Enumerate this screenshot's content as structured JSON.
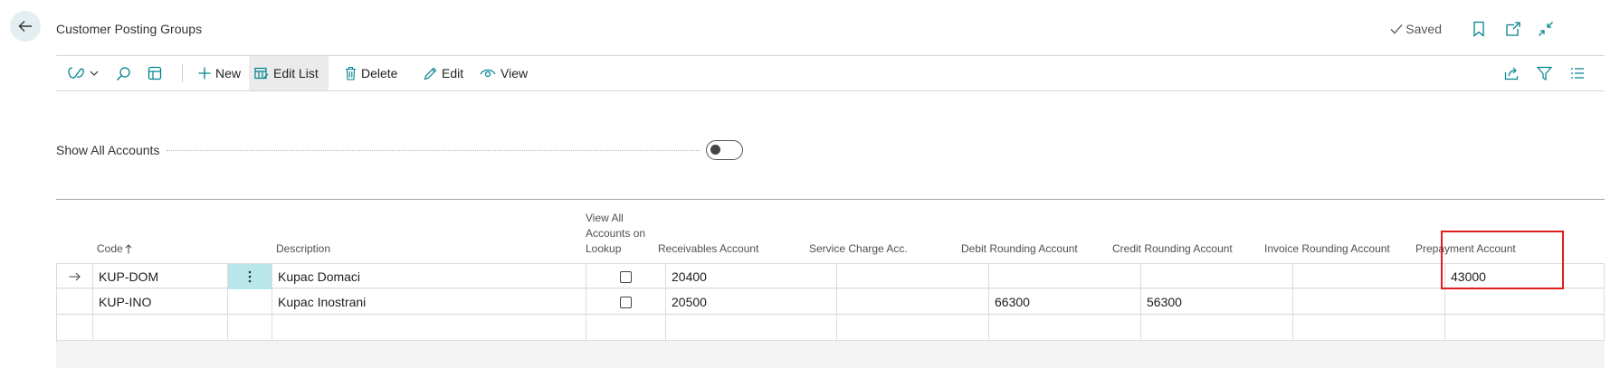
{
  "page": {
    "title": "Customer Posting Groups",
    "status": "Saved"
  },
  "toolbar": {
    "new_label": "New",
    "edit_list_label": "Edit List",
    "delete_label": "Delete",
    "edit_label": "Edit",
    "view_label": "View"
  },
  "options": {
    "show_all_accounts_label": "Show All Accounts",
    "show_all_accounts_value": false
  },
  "table": {
    "headers": {
      "code": "Code",
      "description": "Description",
      "view_all_1": "View All",
      "view_all_2": "Accounts on",
      "view_all_3": "Lookup",
      "receivables": "Receivables Account",
      "service_charge": "Service Charge Acc.",
      "debit_rounding": "Debit Rounding Account",
      "credit_rounding": "Credit Rounding Account",
      "invoice_rounding": "Invoice Rounding Account",
      "prepayment": "Prepayment Account"
    },
    "sort": {
      "column": "Code",
      "direction": "ascending"
    },
    "rows": [
      {
        "code": "KUP-DOM",
        "description": "Kupac Domaci",
        "view_all": false,
        "receivables": "20400",
        "service_charge": "",
        "debit_rounding": "",
        "credit_rounding": "",
        "invoice_rounding": "",
        "prepayment": "43000"
      },
      {
        "code": "KUP-INO",
        "description": "Kupac Inostrani",
        "view_all": false,
        "receivables": "20500",
        "service_charge": "",
        "debit_rounding": "66300",
        "credit_rounding": "56300",
        "invoice_rounding": "",
        "prepayment": ""
      }
    ]
  },
  "colors": {
    "accent": "#00838f",
    "highlight": "#e0201e",
    "selected_cell": "#b8e6ea"
  }
}
